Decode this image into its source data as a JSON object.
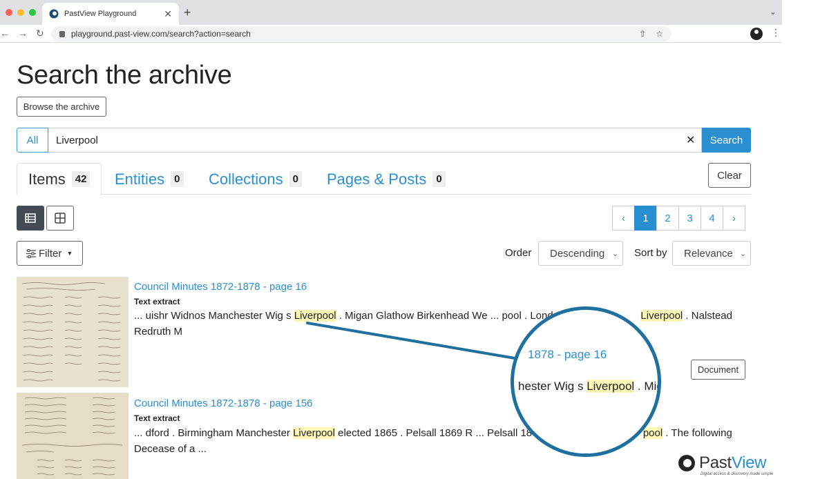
{
  "browser": {
    "tab_title": "PastView Playground",
    "url": "playground.past-view.com/search?action=search"
  },
  "page": {
    "title": "Search the archive",
    "browse_label": "Browse the archive"
  },
  "search": {
    "scope": "All",
    "query": "Liverpool",
    "button_label": "Search",
    "clear_label": "Clear"
  },
  "tabs": [
    {
      "label": "Items",
      "count": "42"
    },
    {
      "label": "Entities",
      "count": "0"
    },
    {
      "label": "Collections",
      "count": "0"
    },
    {
      "label": "Pages & Posts",
      "count": "0"
    }
  ],
  "pagination": {
    "pages": [
      "1",
      "2",
      "3",
      "4"
    ],
    "current": "1"
  },
  "toolbar": {
    "filter_label": "Filter",
    "order_label": "Order",
    "order_value": "Descending",
    "sort_label": "Sort by",
    "sort_value": "Relevance"
  },
  "results": [
    {
      "title": "Council Minutes 1872-1878 - page 16",
      "type_label": "Text extract",
      "extract_before": "... uishr Widnos Manchester Wig s ",
      "extract_hl": "Liverpool",
      "extract_mid": " . Migan Glathow Birkenhead We ... pool . London",
      "extract_hl2": "Liverpool",
      "extract_after": " . Nalstead",
      "extract_line2": "Redruth M",
      "badge": "Document"
    },
    {
      "title": "Council Minutes 1872-1878 - page 156",
      "type_label": "Text extract",
      "extract_before": "... dford . Birmingham Manchester ",
      "extract_hl": "Liverpool",
      "extract_mid": " elected 1865 . Pelsall 1869 R ... Pelsall 1869",
      "extract_hl2": "pool",
      "extract_after": " . The following",
      "extract_line2": "Decease of a ..."
    }
  ],
  "magnifier": {
    "title_fragment": "1878 - page 16",
    "text_before": "hester Wig s ",
    "text_hl": "Liverpool",
    "text_after": " . Miga"
  },
  "brand": {
    "name_a": "Past",
    "name_b": "View",
    "tagline": "Digital access & discovery made simple"
  },
  "colors": {
    "accent": "#2a8fd0",
    "highlight": "#fdf6b6",
    "lens_border": "#1f6f9f"
  }
}
